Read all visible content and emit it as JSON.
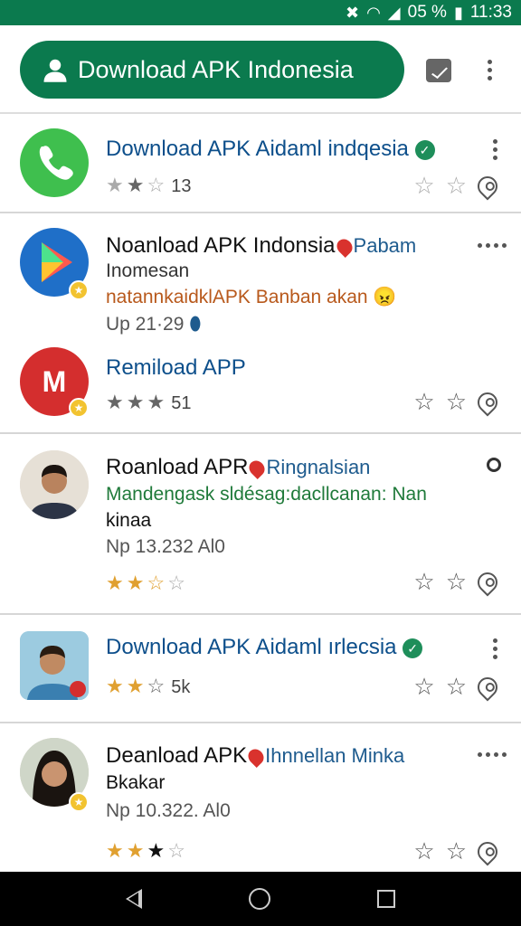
{
  "status_bar": {
    "battery": "05 %",
    "time": "11:33"
  },
  "header": {
    "download_button_label": "Download APK Indonesia"
  },
  "apps": [
    {
      "title": "Download APK Aidaml indqesia",
      "rating_count": "13"
    },
    {
      "title": "Noanload APK Indonsia",
      "title_suffix": "Pabam",
      "line1": "Inomesan",
      "line2": "natannkaidklAPK Banban akan",
      "line3": "Up 21·29"
    },
    {
      "title": "Remiload APP",
      "rating_count": "51"
    },
    {
      "title": "Roanload APR",
      "title_suffix": "Ringnalsian",
      "line1": "Mandengask  sldésag:dacllcanan: Nan",
      "line2": "kinaa",
      "line3": "Np 13.232 Al0"
    },
    {
      "title": "Download APK Aidaml ırlecsia",
      "rating_count": "5k"
    },
    {
      "title": "Deanload APK",
      "title_suffix": "Ihnnellan Minka",
      "line1": "Bkakar",
      "line2": "Np 10.322. Al0"
    }
  ],
  "colors": {
    "brand_green": "#0b7a4e",
    "title_blue": "#0d4f8b",
    "star_gold": "#e0a030"
  }
}
